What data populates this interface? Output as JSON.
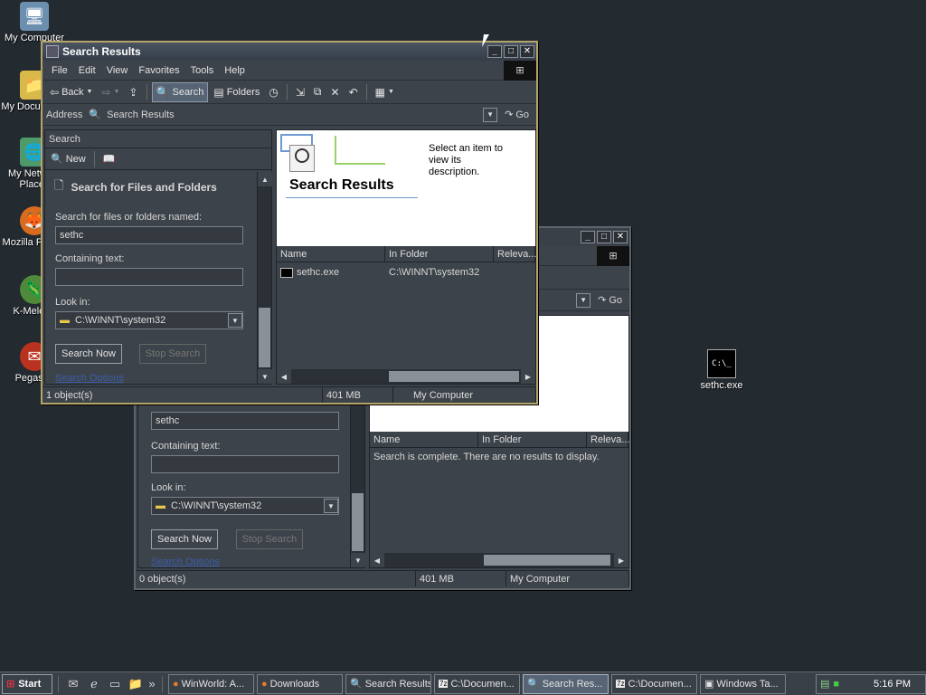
{
  "desktop": {
    "icons": [
      {
        "label": "My Computer",
        "icon": "computer-icon"
      },
      {
        "label": "My Documents",
        "icon": "folder-icon"
      },
      {
        "label": "My Network Places",
        "icon": "network-icon"
      },
      {
        "label": "Mozilla Firefox",
        "icon": "firefox-icon"
      },
      {
        "label": "K-Meleon",
        "icon": "kmeleon-icon"
      },
      {
        "label": "Pegasus",
        "icon": "pegasus-icon"
      }
    ],
    "file_icon": {
      "label": "sethc.exe",
      "glyph": "C:\\_"
    }
  },
  "front_window": {
    "title": "Search Results",
    "menu": [
      "File",
      "Edit",
      "View",
      "Favorites",
      "Tools",
      "Help"
    ],
    "toolbar": {
      "back": "Back",
      "search": "Search",
      "folders": "Folders"
    },
    "address": {
      "label": "Address",
      "value": "Search Results",
      "go": "Go"
    },
    "search_pane": {
      "header": "Search",
      "new_label": "New",
      "section_title": "Search for Files and Folders",
      "named_label": "Search for files or folders named:",
      "named_value": "sethc",
      "containing_label": "Containing text:",
      "containing_value": "",
      "lookin_label": "Look in:",
      "lookin_value": "C:\\WINNT\\system32",
      "search_now": "Search Now",
      "stop_search": "Stop Search",
      "options_link": "Search Options"
    },
    "banner": {
      "title": "Search Results",
      "hint": "Select an item to view its description."
    },
    "columns": [
      "Name",
      "In Folder",
      "Releva..."
    ],
    "rows": [
      {
        "name": "sethc.exe",
        "folder": "C:\\WINNT\\system32"
      }
    ],
    "status": {
      "count": "1 object(s)",
      "size": "401 MB",
      "zone": "My Computer"
    }
  },
  "back_window": {
    "address_go": "Go",
    "search_pane": {
      "named_value": "sethc",
      "containing_label": "Containing text:",
      "lookin_label": "Look in:",
      "lookin_value": "C:\\WINNT\\system32",
      "search_now": "Search Now",
      "stop_search": "Stop Search",
      "options_link": "Search Options"
    },
    "columns": [
      "Name",
      "In Folder",
      "Releva..."
    ],
    "empty_message": "Search is complete. There are no results to display.",
    "status": {
      "count": "0 object(s)",
      "size": "401 MB",
      "zone": "My Computer"
    }
  },
  "taskbar": {
    "start": "Start",
    "tasks": [
      {
        "label": "WinWorld: A...",
        "pressed": false
      },
      {
        "label": "Downloads",
        "pressed": false
      },
      {
        "label": "Search Results",
        "pressed": false
      },
      {
        "label": "C:\\Documen...",
        "pressed": false
      },
      {
        "label": "Search Res...",
        "pressed": true
      },
      {
        "label": "C:\\Documen...",
        "pressed": false
      },
      {
        "label": "Windows Ta...",
        "pressed": false
      }
    ],
    "clock": "5:16 PM"
  }
}
